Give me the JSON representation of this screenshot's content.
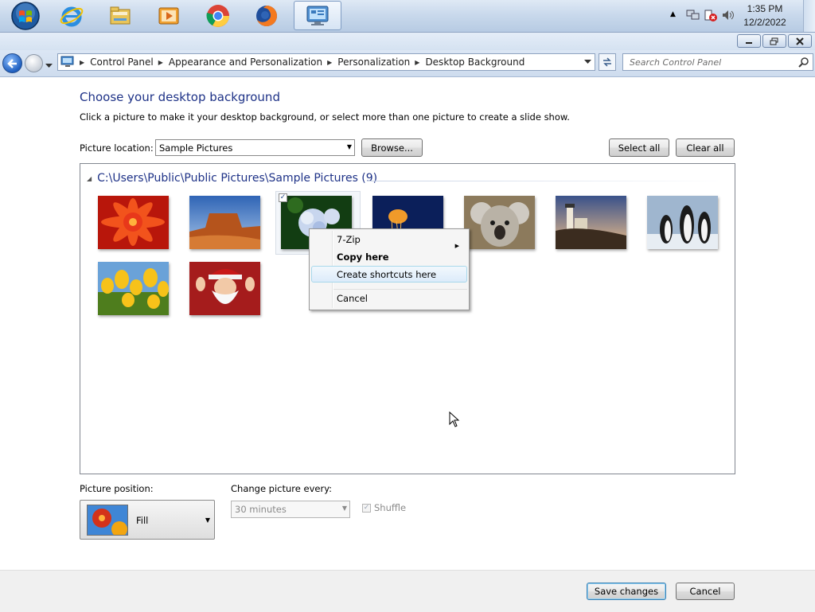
{
  "taskbar": {
    "pinned": [
      {
        "name": "internet-explorer-icon"
      },
      {
        "name": "windows-explorer-icon"
      },
      {
        "name": "media-player-icon"
      },
      {
        "name": "chrome-icon"
      },
      {
        "name": "firefox-icon"
      },
      {
        "name": "control-panel-icon",
        "active": true
      }
    ],
    "clock_time": "1:35 PM",
    "clock_date": "12/2/2022"
  },
  "address": {
    "breadcrumbs": [
      "Control Panel",
      "Appearance and Personalization",
      "Personalization",
      "Desktop Background"
    ],
    "search_placeholder": "Search Control Panel"
  },
  "page": {
    "title": "Choose your desktop background",
    "subtitle": "Click a picture to make it your desktop background, or select more than one picture to create a slide show.",
    "location_label": "Picture location:",
    "location_value": "Sample Pictures",
    "browse_label": "Browse...",
    "select_all_label": "Select all",
    "clear_all_label": "Clear all"
  },
  "gallery": {
    "group_label": "C:\\Users\\Public\\Public Pictures\\Sample Pictures (9)",
    "images": [
      {
        "name": "chrysanthemum",
        "checked": false
      },
      {
        "name": "desert",
        "checked": false
      },
      {
        "name": "hydrangeas",
        "checked": true
      },
      {
        "name": "jellyfish",
        "checked": false
      },
      {
        "name": "koala",
        "checked": false
      },
      {
        "name": "lighthouse",
        "checked": false
      },
      {
        "name": "penguins",
        "checked": false
      },
      {
        "name": "tulips",
        "checked": false
      },
      {
        "name": "santa",
        "checked": false
      }
    ]
  },
  "context_menu": {
    "items": [
      "7-Zip",
      "Copy here",
      "Create shortcuts here",
      "Cancel"
    ],
    "highlighted": "Create shortcuts here"
  },
  "bottom": {
    "position_label": "Picture position:",
    "position_value": "Fill",
    "interval_label": "Change picture every:",
    "interval_value": "30 minutes",
    "shuffle_label": "Shuffle",
    "shuffle_checked": true,
    "save_label": "Save changes",
    "cancel_label": "Cancel"
  },
  "colors": {
    "title_blue": "#1e3287",
    "accent_blue": "#3c7fb1"
  }
}
